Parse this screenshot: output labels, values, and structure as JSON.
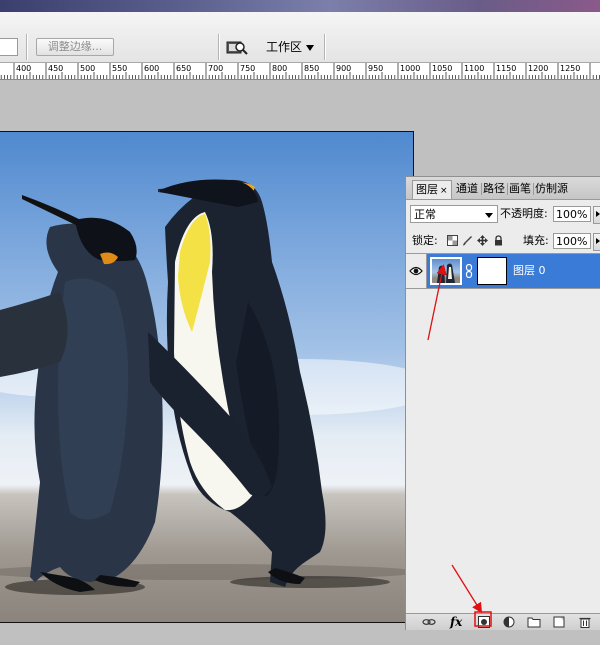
{
  "options_bar": {
    "refine_edge_label": "调整边缘...",
    "workspace_label": "工作区"
  },
  "ruler": {
    "ticks": [
      "400",
      "450",
      "500",
      "550",
      "600",
      "650",
      "700",
      "750",
      "800",
      "850",
      "900",
      "950",
      "1000",
      "1050",
      "1100",
      "1150",
      "1200",
      "1250"
    ]
  },
  "layers_panel": {
    "tabs": [
      {
        "label": "图层",
        "active": true
      },
      {
        "label": "通道",
        "active": false
      },
      {
        "label": "路径",
        "active": false
      },
      {
        "label": "画笔",
        "active": false
      },
      {
        "label": "仿制源",
        "active": false
      }
    ],
    "close_glyph": "×",
    "blend_mode": "正常",
    "opacity_label": "不透明度:",
    "opacity_value": "100%",
    "lock_label": "锁定:",
    "fill_label": "填充:",
    "fill_value": "100%",
    "layer": {
      "name": "图层 0"
    },
    "fx_label": "fx"
  },
  "colors": {
    "selection_blue": "#3a7bd8",
    "annotation_red": "#e01010"
  },
  "icons": [
    "eye-icon",
    "chain-link-icon",
    "link-layers-icon",
    "fx-icon",
    "add-mask-icon",
    "adjustment-layer-icon",
    "new-group-icon",
    "new-layer-icon",
    "trash-icon",
    "lock-transparent-icon",
    "lock-brush-icon",
    "lock-move-icon",
    "lock-all-icon",
    "zoom-workspace-icon"
  ]
}
